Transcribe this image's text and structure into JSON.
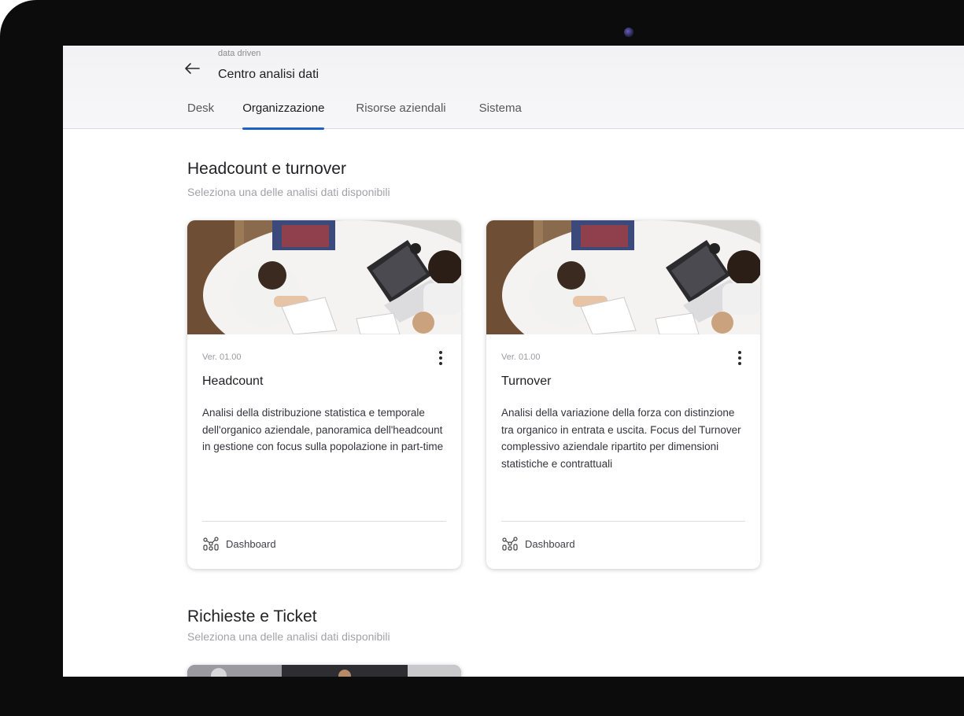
{
  "header": {
    "breadcrumb_parent": "data driven",
    "page_title": "Centro analisi dati",
    "back_icon": "arrow-left-icon"
  },
  "tabs": [
    {
      "label": "Desk",
      "active": false
    },
    {
      "label": "Organizzazione",
      "active": true
    },
    {
      "label": "Risorse aziendali",
      "active": false
    },
    {
      "label": "Sistema",
      "active": false
    }
  ],
  "sections": [
    {
      "title": "Headcount e turnover",
      "subtitle": "Seleziona una delle analisi dati disponibili",
      "cards": [
        {
          "version": "Ver. 01.00",
          "title": "Headcount",
          "description": "Analisi della distribuzione statistica e temporale dell'organico aziendale, panoramica dell'headcount in gestione con focus sulla popolazione in part-time",
          "footer_label": "Dashboard",
          "footer_icon": "dashboard-chart-icon",
          "menu_icon": "more-vertical-icon"
        },
        {
          "version": "Ver. 01.00",
          "title": "Turnover",
          "description": "Analisi della variazione della forza con distinzione tra organico in entrata e uscita. Focus del Turnover complessivo aziendale ripartito per dimensioni statistiche e contrattuali",
          "footer_label": "Dashboard",
          "footer_icon": "dashboard-chart-icon",
          "menu_icon": "more-vertical-icon"
        }
      ]
    },
    {
      "title": "Richieste e Ticket",
      "subtitle": "Seleziona una delle analisi dati disponibili"
    }
  ],
  "colors": {
    "accent": "#1b64c4",
    "device_frame": "#0c0c0c",
    "background_strip": "#1976d2"
  }
}
